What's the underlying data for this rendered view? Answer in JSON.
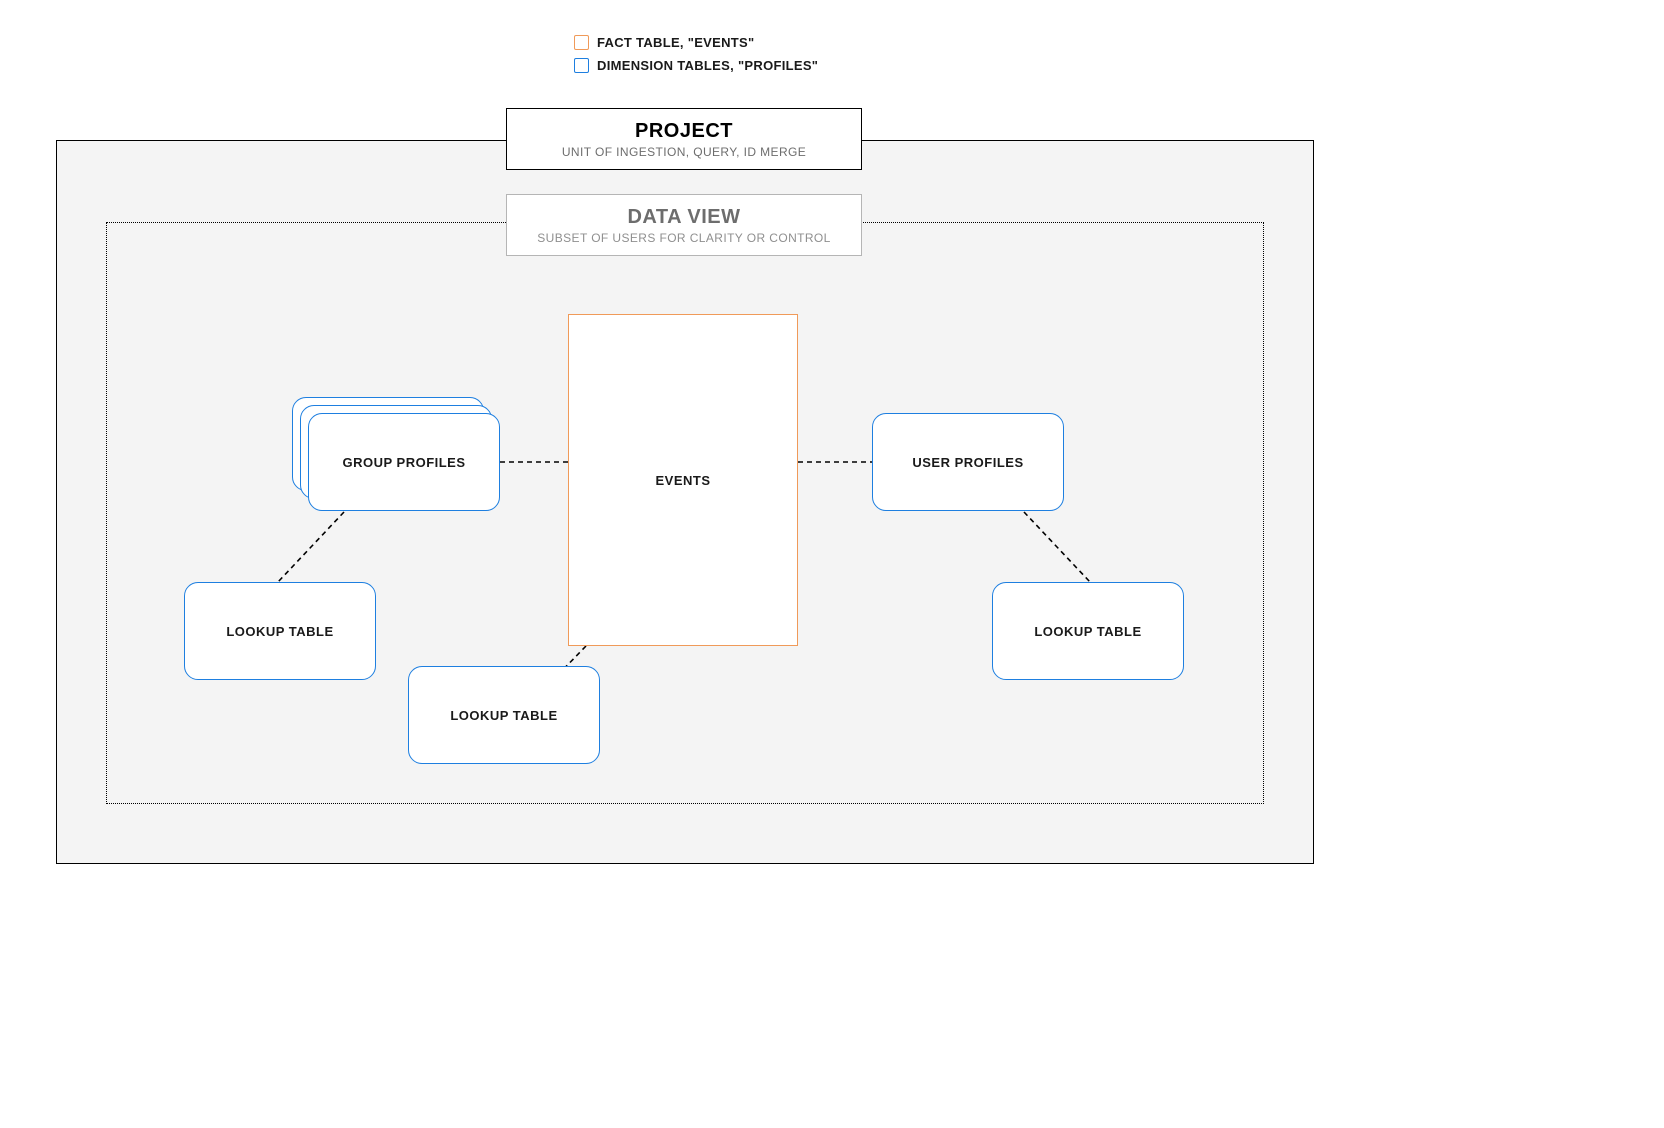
{
  "legend": {
    "fact_label": "FACT TABLE, \"EVENTS\"",
    "dimension_label": "DIMENSION TABLES, \"PROFILES\""
  },
  "project": {
    "title": "PROJECT",
    "subtitle": "UNIT OF INGESTION, QUERY, ID MERGE"
  },
  "dataview": {
    "title": "DATA VIEW",
    "subtitle": "SUBSET OF USERS FOR CLARITY OR CONTROL"
  },
  "nodes": {
    "events": "EVENTS",
    "group_profiles": "GROUP PROFILES",
    "user_profiles": "USER PROFILES",
    "lookup_left": "LOOKUP TABLE",
    "lookup_center": "LOOKUP TABLE",
    "lookup_right": "LOOKUP TABLE"
  },
  "colors": {
    "fact_border": "#F09A59",
    "dimension_border": "#1E7FE0",
    "bg_grey": "#F4F4F4"
  }
}
